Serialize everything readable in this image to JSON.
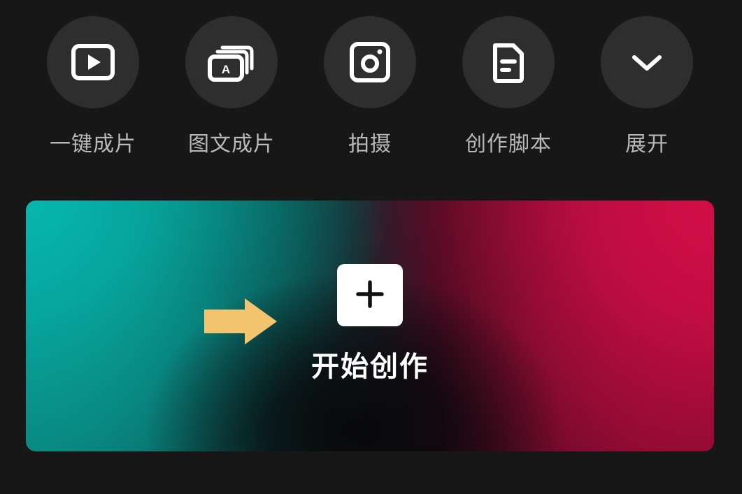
{
  "toolbar": {
    "items": [
      {
        "label": "一键成片",
        "icon": "play-icon"
      },
      {
        "label": "图文成片",
        "icon": "text-card-icon"
      },
      {
        "label": "拍摄",
        "icon": "camera-icon"
      },
      {
        "label": "创作脚本",
        "icon": "document-icon"
      },
      {
        "label": "展开",
        "icon": "chevron-down-icon"
      }
    ]
  },
  "banner": {
    "label": "开始创作",
    "button_icon": "plus-icon",
    "pointer_icon": "arrow-right-icon"
  },
  "colors": {
    "background": "#171717",
    "circle": "#2e2e2e",
    "label": "#b9b9b9",
    "teal": "#06b7ae",
    "crimson": "#d20e47",
    "arrow": "#f2c46e"
  }
}
